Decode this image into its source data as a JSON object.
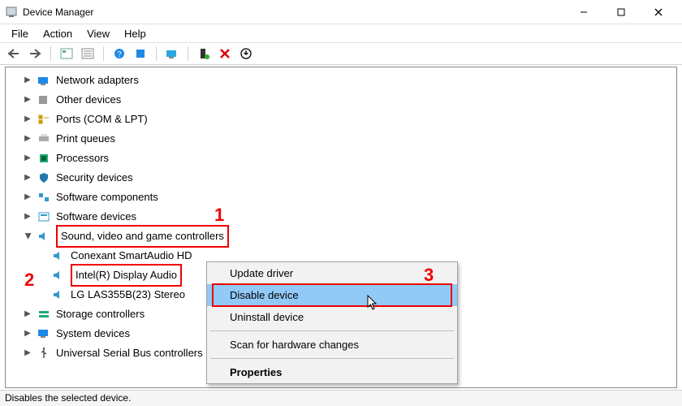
{
  "window": {
    "title": "Device Manager"
  },
  "menu": {
    "items": [
      "File",
      "Action",
      "View",
      "Help"
    ]
  },
  "tree": {
    "categories": [
      {
        "label": "Network adapters"
      },
      {
        "label": "Other devices"
      },
      {
        "label": "Ports (COM & LPT)"
      },
      {
        "label": "Print queues"
      },
      {
        "label": "Processors"
      },
      {
        "label": "Security devices"
      },
      {
        "label": "Software components"
      },
      {
        "label": "Software devices"
      },
      {
        "label": "Sound, video and game controllers",
        "expanded": true,
        "children": [
          {
            "label": "Conexant SmartAudio HD"
          },
          {
            "label": "Intel(R) Display Audio",
            "selected": true
          },
          {
            "label": "LG LAS355B(23) Stereo"
          }
        ]
      },
      {
        "label": "Storage controllers"
      },
      {
        "label": "System devices"
      },
      {
        "label": "Universal Serial Bus controllers"
      }
    ]
  },
  "context_menu": {
    "items": [
      {
        "label": "Update driver"
      },
      {
        "label": "Disable device",
        "hovered": true
      },
      {
        "label": "Uninstall device"
      },
      {
        "separator": true
      },
      {
        "label": "Scan for hardware changes"
      },
      {
        "separator": true
      },
      {
        "label": "Properties",
        "bold": true
      }
    ]
  },
  "statusbar": {
    "text": "Disables the selected device."
  },
  "annotations": {
    "marker1": "1",
    "marker2": "2",
    "marker3": "3"
  }
}
